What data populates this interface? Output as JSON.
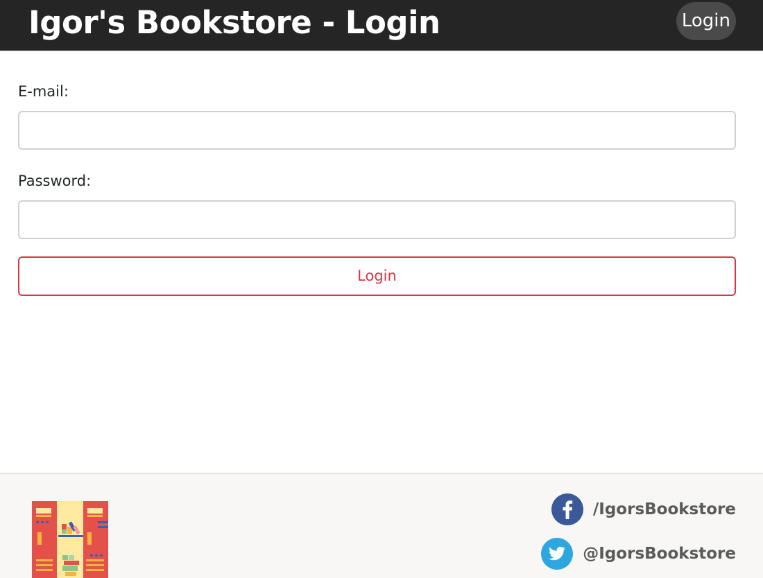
{
  "navbar": {
    "brand": "Igor's Bookstore - Login",
    "login_label": "Login",
    "background": "#252525",
    "login_pill_color": "#4a4a4a"
  },
  "form": {
    "email_label": "E-mail:",
    "email_value": "",
    "password_label": "Password:",
    "password_value": "",
    "submit_label": "Login",
    "submit_color": "#dc3545"
  },
  "footer": {
    "logo_icon": "bookshelf-logo",
    "social": [
      {
        "icon": "facebook-icon",
        "handle": "/IgorsBookstore",
        "color": "#3b5998"
      },
      {
        "icon": "twitter-icon",
        "handle": "@IgorsBookstore",
        "color": "#1da1f2"
      }
    ]
  }
}
